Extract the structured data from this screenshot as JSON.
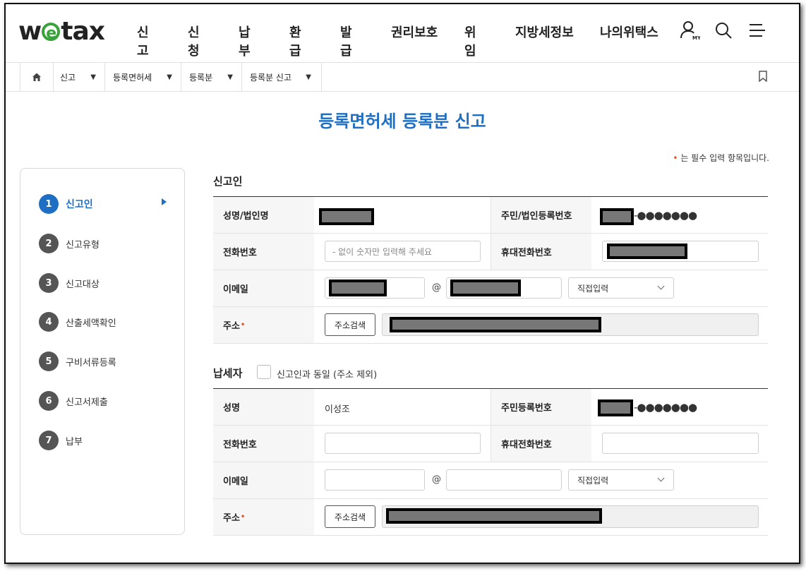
{
  "header": {
    "logo_pre": "w",
    "logo_e": "e",
    "logo_post": "tax",
    "nav": [
      "신고",
      "신청",
      "납부",
      "환급",
      "발급",
      "권리보호",
      "위임",
      "지방세정보",
      "나의위택스"
    ],
    "my_label": "MY"
  },
  "breadcrumb": [
    "신고",
    "등록면허세",
    "등록분",
    "등록분 신고"
  ],
  "page_title": "등록면허세 등록분 신고",
  "required_note": "는 필수 입력 항목입니다.",
  "required_mark": "•",
  "steps": [
    {
      "num": "1",
      "label": "신고인",
      "active": true
    },
    {
      "num": "2",
      "label": "신고유형"
    },
    {
      "num": "3",
      "label": "신고대상"
    },
    {
      "num": "4",
      "label": "산출세액확인"
    },
    {
      "num": "5",
      "label": "구비서류등록"
    },
    {
      "num": "6",
      "label": "신고서제출"
    },
    {
      "num": "7",
      "label": "납부"
    }
  ],
  "reporter": {
    "section_title": "신고인",
    "name_label": "성명/법인명",
    "id_label": "주민/법인등록번호",
    "id_masked": "-●●●●●●●",
    "phone_label": "전화번호",
    "phone_placeholder": "- 없이 숫자만 입력해 주세요",
    "mobile_label": "휴대전화번호",
    "email_label": "이메일",
    "at": "@",
    "email_domain_select": "직접입력",
    "address_label": "주소",
    "address_button": "주소검색"
  },
  "taxpayer": {
    "section_title": "납세자",
    "same_checkbox_label": "신고인과 동일 (주소 제외)",
    "name_label": "성명",
    "name_value": "이성조",
    "id_label": "주민등록번호",
    "id_masked": "-●●●●●●●",
    "phone_label": "전화번호",
    "mobile_label": "휴대전화번호",
    "email_label": "이메일",
    "at": "@",
    "email_domain_select": "직접입력",
    "address_label": "주소",
    "address_button": "주소검색"
  },
  "colors": {
    "accent": "#1e6fc4",
    "required": "#d9531e",
    "logo_e": "#3aa23a"
  }
}
